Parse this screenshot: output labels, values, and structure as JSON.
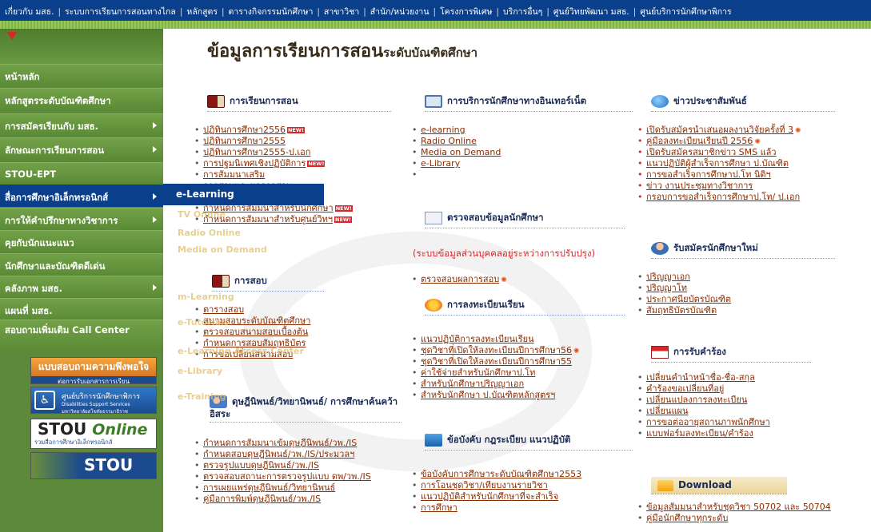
{
  "topnav": [
    "เกี่ยวกับ มสธ.",
    "ระบบการเรียนการสอนทางไกล",
    "หลักสูตร",
    "ตารางกิจกรรมนักศึกษา",
    "สาขาวิชา",
    "สำนัก/หน่วยงาน",
    "โครงการพิเศษ",
    "บริการอื่นๆ",
    "ศูนย์วิทยพัฒนา มสธ.",
    "ศูนย์บริการนักศึกษาพิการ"
  ],
  "sidebar": {
    "items": [
      {
        "label": "หน้าหลัก"
      },
      {
        "label": "หลักสูตรระดับบัณฑิตศึกษา"
      },
      {
        "label": "การสมัครเรียนกับ มสธ."
      },
      {
        "label": "ลักษณะการเรียนการสอน"
      },
      {
        "label": "STOU-EPT"
      },
      {
        "label": "สื่อการศึกษาอิเล็กทรอนิกส์"
      },
      {
        "label": "การให้คำปรึกษาทางวิชาการ"
      },
      {
        "label": "คุยกับนักแนะแนว"
      },
      {
        "label": "นักศึกษาและบัณฑิตดีเด่น"
      },
      {
        "label": "คลังภาพ มสธ."
      },
      {
        "label": "แผนที่ มสธ."
      },
      {
        "label": "สอบถามเพิ่มเติม Call Center"
      }
    ],
    "banners": {
      "survey_title": "แบบสอบถามความพึงพอใจ",
      "survey_sub": "ต่อการรับเอกสารการเรียน",
      "disability_title": "ศูนย์บริการนักศึกษาพิการ",
      "disability_sub1": "Disabilities Support Services",
      "disability_sub2": "มหาวิทยาลัยสุโขทัยธรรมาธิราช",
      "online_stou": "STOU",
      "online_word": "Online",
      "online_sub": "รวมสื่อการศึกษาอิเล็กทรอนิกส์",
      "stou_label": "STOU"
    }
  },
  "dropdown": {
    "label": "e-Learning"
  },
  "submenu_ghost": [
    "TV Online",
    "Radio Online",
    "Media on Demand",
    "m-Learning",
    "e-Tutorials",
    "e-Learning Access Center",
    "e-Library",
    "e-Training"
  ],
  "page_title": {
    "main": "ข้อมูลการเรียนการสอน",
    "sub": "ระดับบัณฑิตศึกษา"
  },
  "col1": {
    "teaching_head": "การเรียนการสอน",
    "teaching_links": [
      "ปฏิทินการศึกษา2556",
      "ปฏิทินการศึกษา2555",
      "ปฏิทินการศึกษา2555-ป.เอก",
      "การปฐมนิเทศเชิงปฏิบัติการ",
      "การสัมมนาเสริม",
      "การสอบและผลการสอบ",
      "แผนกิจกรรมการศึกษา",
      "กำหนดการสัมมนาสำหรับนักศึกษา",
      "กำหนดการสัมมนาสำหรับศูนย์วิทฯ"
    ],
    "exam_head": "การสอบ",
    "exam_links": [
      "ตารางสอบ",
      "สนามสอบระดับบัณฑิตศึกษา",
      "ตรวจสอบสนามสอบเบื้องต้น",
      "กำหนดการสอบสัมฤทธิบัตร",
      "การขอเปลี่ยนสนามสอบ"
    ],
    "thesis_head": "ดุษฎีนิพนธ์/วิทยานิพนธ์/ การศึกษาค้นคว้าอิสระ",
    "thesis_links": [
      "กำหนดการสัมมนาเข้มดุษฎีนิพนธ์/วพ./IS",
      "กำหนดสอบดุษฎีนิพนธ์/วพ./IS/ประมวลฯ",
      "ตรวจรูปแบบดุษฎีนิพนธ์/วพ./IS",
      "ตรวจสอบสถานะการตรวจรูปแบบ ดพ/วพ./IS",
      "การเผยแพร่ดุษฎีนิพนธ์/วิทยานิพนธ์",
      "คู่มือการพิมพ์ดุษฎีนิพนธ์/วพ./IS"
    ],
    "new_badge": "NEW!"
  },
  "col2": {
    "internet_head": "การบริการนักศึกษาทางอินเทอร์เน็ต",
    "internet_links": [
      "e-learning",
      "Radio Online",
      "Media on Demand",
      "e-Library",
      ""
    ],
    "check_head": "ตรวจสอบข้อมูลนักศึกษา",
    "check_note": "(ระบบข้อมูลส่วนบุคคลอยู่ระหว่างการปรับปรุง)",
    "check_links": [
      "ตรวจสอบผลการสอบ"
    ],
    "register_head": "การลงทะเบียนเรียน",
    "register_links": [
      "แนวปฏิบัติการลงทะเบียนเรียน",
      "ชุดวิชาที่เปิดให้ลงทะเบียนปีการศึกษา56",
      "ชุดวิชาที่เปิดให้ลงทะเบียนปีการศึกษา55",
      "ค่าใช้จ่ายสำหรับนักศึกษาป.โท",
      "สำหรับนักศึกษาปริญญาเอก",
      "สำหรับนักศึกษา ป.บัณฑิตหลักสูตรฯ"
    ],
    "rules_head": "ข้อบังคับ กฎระเบียบ แนวปฏิบัติ",
    "rules_links": [
      "ข้อบังคับการศึกษาระดับบัณฑิตศึกษา2553",
      "การโอนชุดวิชา/เทียบงานรายวิชา",
      "แนวปฏิบัติสำหรับนักศึกษาที่จะสำเร็จ",
      "การศึกษา"
    ]
  },
  "col3": {
    "news_head": "ข่าวประชาสัมพันธ์",
    "news_links": [
      "เปิดรับสมัครนำเสนอผลงานวิจัยครั้งที่ 3",
      "คู่มือลงทะเบียนเรียนปี 2556",
      "เปิดรับสมัครสมาชิกข่าว SMS แล้ว",
      "แนวปฏิบัติผู้สำเร็จการศึกษา ป.บัณฑิต",
      "การขอสำเร็จการศึกษาป.โท นิติฯ",
      "ข่าว งานประชุมทางวิชาการ",
      "กรอบการขอสำเร็จการศึกษาป.โท/ ป.เอก"
    ],
    "admission_head": "รับสมัครนักศึกษาใหม่",
    "admission_links": [
      "ปริญญาเอก",
      "ปริญญาโท",
      "ประกาศนียบัตรบัณฑิต",
      "สัมฤทธิบัตรบัณฑิต"
    ],
    "petition_head": "การรับคำร้อง",
    "petition_links": [
      "เปลี่ยนคำนำหน้าชื่อ-ชื่อ-สกุล",
      "คำร้องขอเปลี่ยนที่อยู่",
      "เปลี่ยนแปลงการลงทะเบียน",
      "เปลี่ยนแผน",
      "การขอต่ออายุสถานภาพนักศึกษา",
      "แบบฟอร์มลงทะเบียน/คำร้อง"
    ],
    "download_head": "Download",
    "download_links": [
      "ข้อมูลสัมมนาสำหรับชุดวิชา 50702 และ 50704",
      "คู่มือนักศึกษาทุกระดับ"
    ]
  },
  "colors": {
    "topnav": "#0a3f8c",
    "sidebar": "#5d8a3a",
    "link": "#8a2c00",
    "alert": "#d8262b"
  }
}
